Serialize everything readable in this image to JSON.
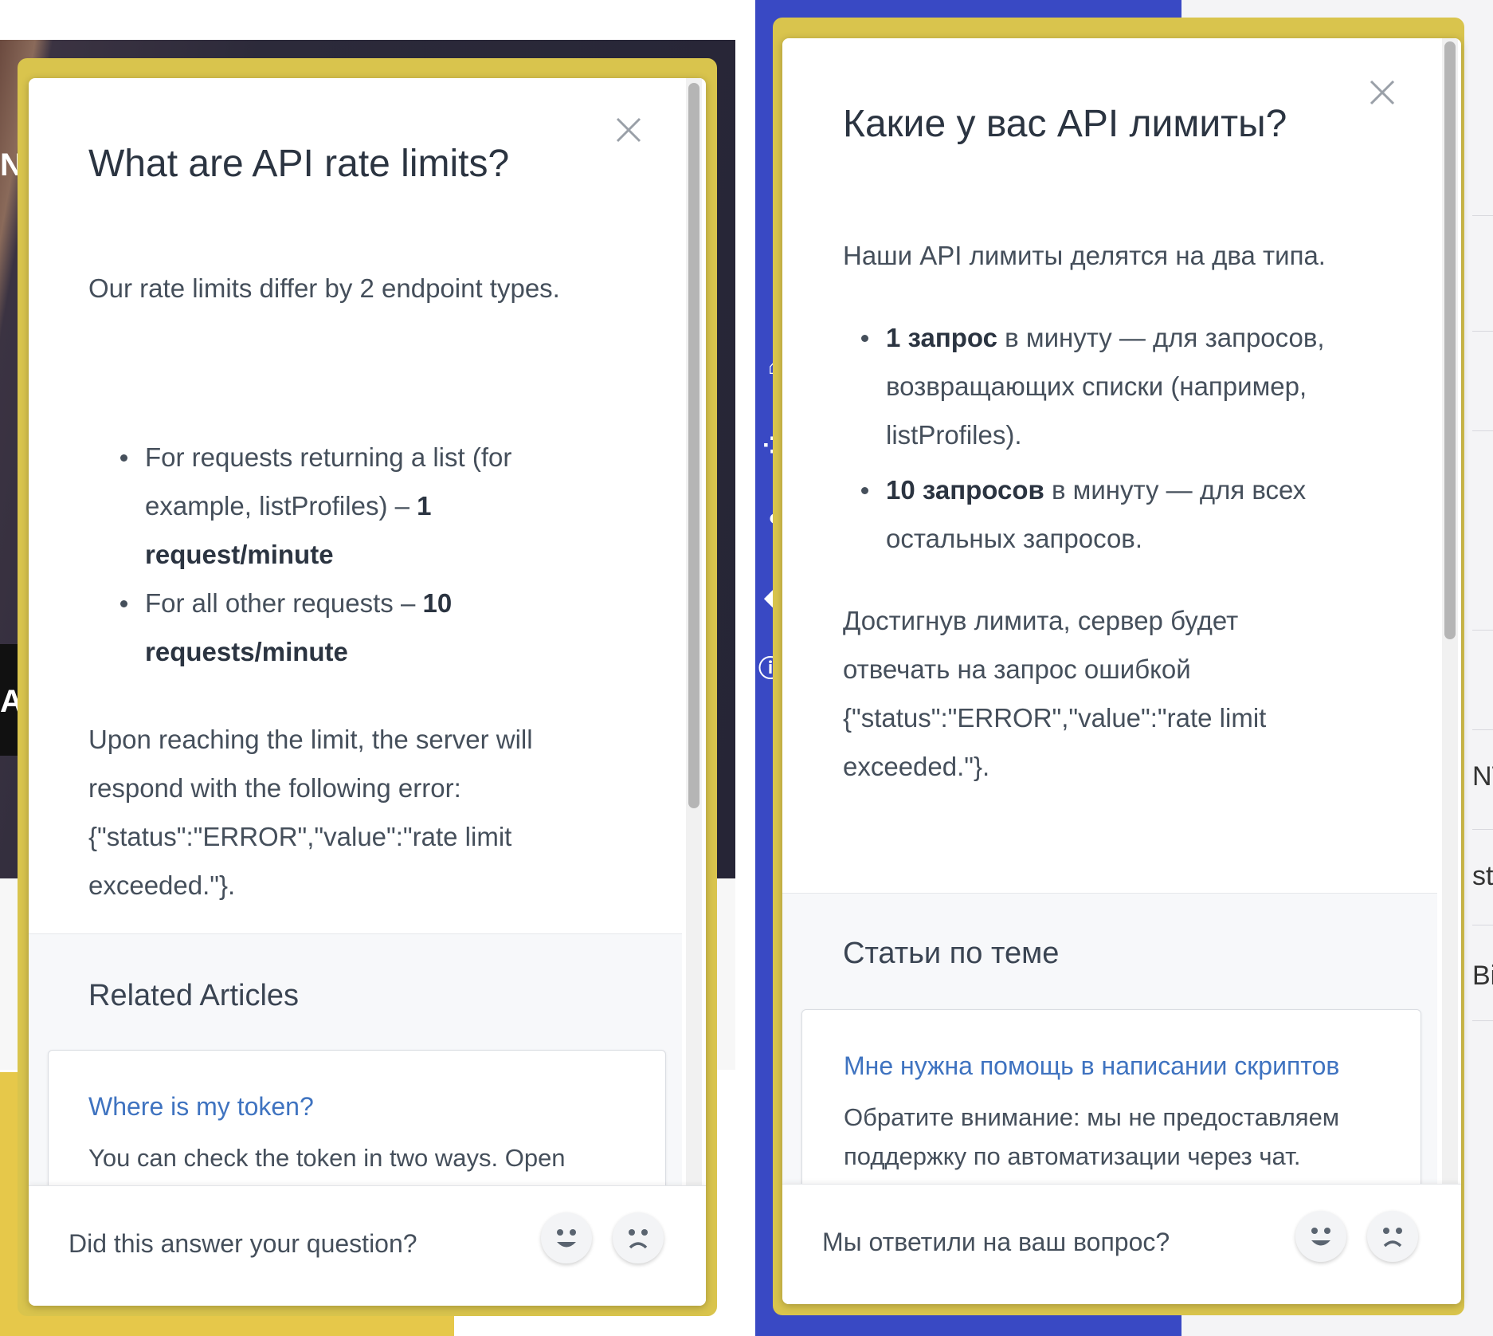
{
  "left_panel": {
    "title": "What are API rate limits?",
    "intro": "Our rate limits differ by 2 endpoint types.",
    "bullets": [
      {
        "text": "For requests returning a list (for example, listProfiles) – ",
        "bold": "1 request/minute"
      },
      {
        "text": "For all other requests – ",
        "bold": "10 requests/minute"
      }
    ],
    "error_line1": "Upon reaching the limit, the server will",
    "error_line2": "respond with the following error:",
    "error_line3": "{\"status\":\"ERROR\",\"value\":\"rate limit",
    "error_line4": "exceeded.\"}.",
    "related_heading": "Related Articles",
    "article_title": "Where is my token?",
    "article_excerpt": "You can check the token in two ways. Open",
    "feedback_question": "Did this answer your question?"
  },
  "right_panel": {
    "title": "Какие у вас API лимиты?",
    "intro": "Наши API лимиты делятся на два типа.",
    "bullet1_bold": "1 запрос",
    "bullet1_text": " в минуту — для запросов, возвращающих списки (например, listProfiles).",
    "bullet2_bold": "10 запросов",
    "bullet2_text": " в минуту — для всех остальных запросов.",
    "error_line1": "Достигнув лимита, сервер будет",
    "error_line2": "отвечать на запрос ошибкой",
    "error_line3": "{\"status\":\"ERROR\",\"value\":\"rate limit",
    "error_line4": "exceeded.\"}.",
    "related_heading": "Статьи по теме",
    "article_title": "Мне нужна помощь в написании скриптов",
    "article_excerpt_line1": "Обратите внимание: мы не предоставляем",
    "article_excerpt_line2": "поддержку по автоматизации через чат.",
    "feedback_question": "Мы ответили на ваш вопрос?"
  },
  "background": {
    "left_edge_chars": [
      "N",
      "A"
    ],
    "right_edge_chars": [
      "NT",
      "ste",
      "Bi"
    ]
  },
  "icons": {
    "close": "close-icon",
    "happy": "happy-face-icon",
    "sad": "sad-face-icon"
  },
  "colors": {
    "frame": "#d9c44d",
    "link": "#3f73c0",
    "sidebar": "#3949c4"
  }
}
